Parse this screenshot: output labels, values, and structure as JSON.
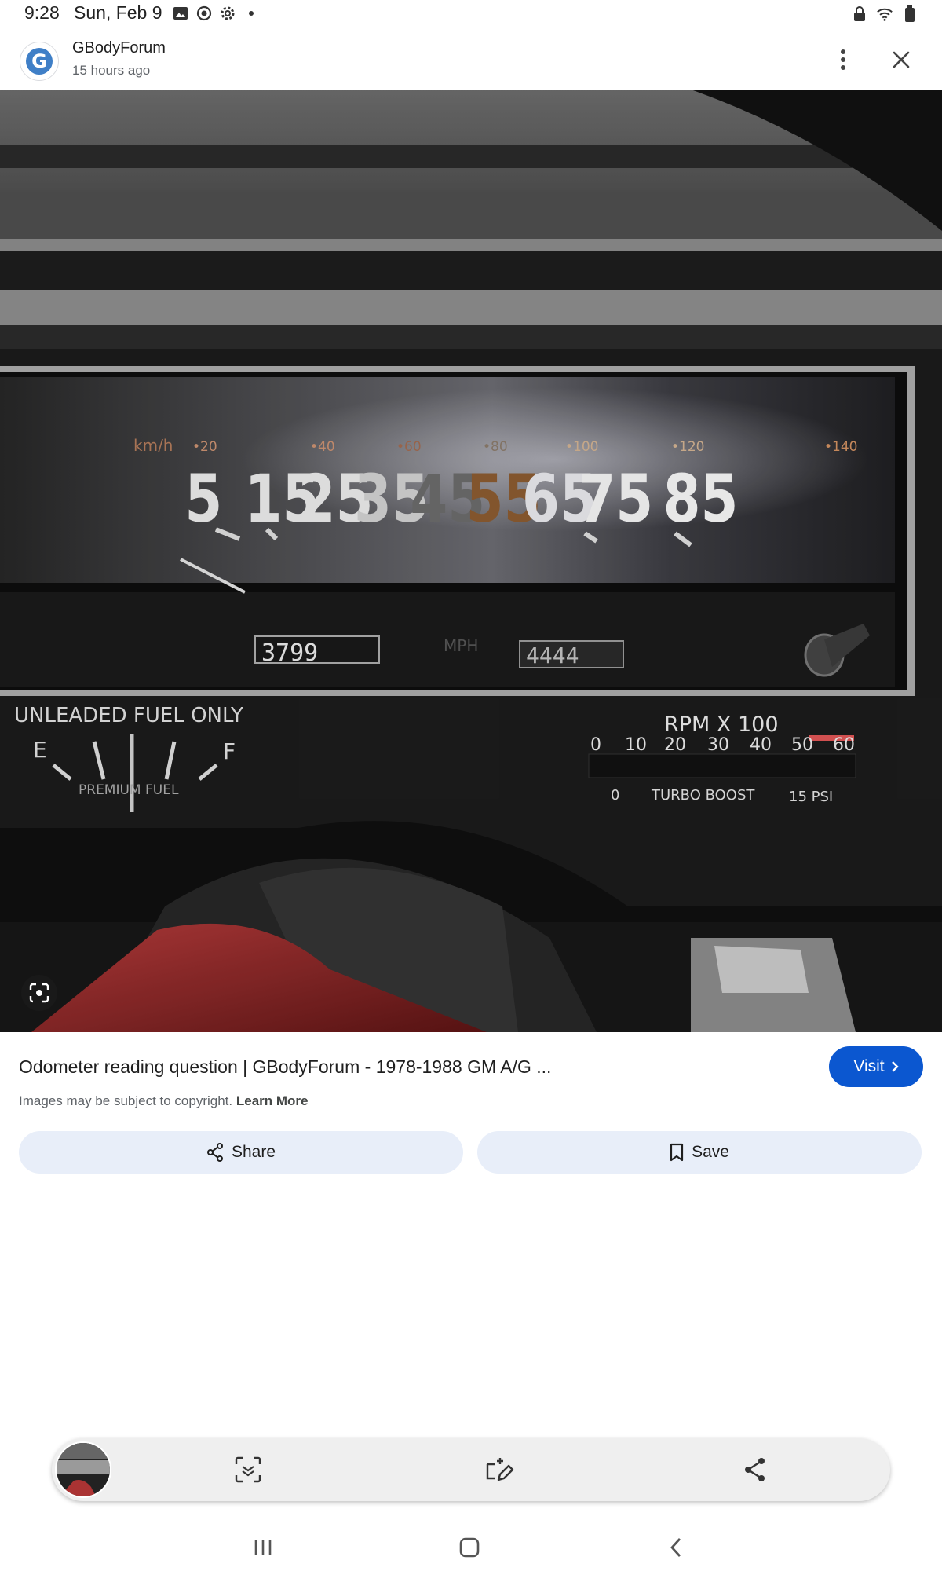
{
  "status_bar": {
    "time": "9:28",
    "date": "Sun, Feb 9",
    "icons_left": [
      "gallery-icon",
      "sync-icon",
      "settings-icon",
      "dot-icon"
    ],
    "icons_right": [
      "lock-icon",
      "wifi-icon",
      "battery-icon"
    ]
  },
  "header": {
    "logo_letter": "G",
    "site_name": "GBodyForum",
    "time_ago": "15 hours ago"
  },
  "photo": {
    "description_icon": "lens-icon",
    "speedo_kmh_label": "km/h",
    "speedo_kmh_marks": [
      "20",
      "40",
      "60",
      "80",
      "100",
      "120",
      "140"
    ],
    "speedo_mph_numbers": [
      "5",
      "15",
      "25",
      "35",
      "45",
      "55",
      "65",
      "75",
      "85"
    ],
    "trip_odometer": "3799",
    "mph_label": "MPH",
    "odometer_digits": "4444",
    "fuel_label": "UNLEADED FUEL ONLY",
    "fuel_e": "E",
    "fuel_f": "F",
    "premium_label": "PREMIUM FUEL",
    "rpm_label": "RPM X 100",
    "rpm_ticks": [
      "0",
      "10",
      "20",
      "30",
      "40",
      "50",
      "60"
    ],
    "boost_zero": "0",
    "boost_label": "TURBO BOOST",
    "boost_max": "15 PSI"
  },
  "result": {
    "title": "Odometer reading question | GBodyForum - 1978-1988 GM A/G ...",
    "visit_label": "Visit",
    "copyright_text": "Images may be subject to copyright.",
    "learn_more": "Learn More",
    "share_label": "Share",
    "save_label": "Save"
  },
  "toolbar": {
    "buttons": [
      "thumbnail",
      "scan-text-icon",
      "edit-crop-icon",
      "share-icon"
    ]
  },
  "nav": {
    "buttons": [
      "recents-icon",
      "home-icon",
      "back-icon"
    ]
  }
}
